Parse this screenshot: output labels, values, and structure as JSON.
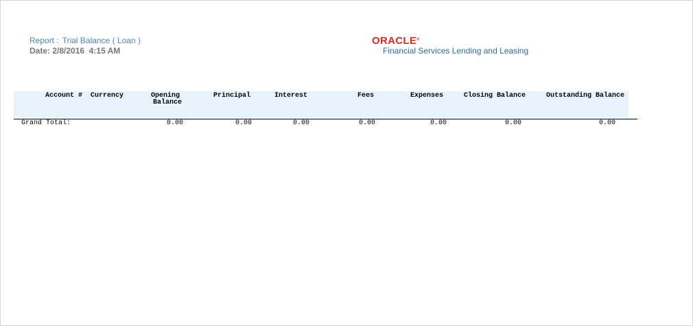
{
  "report": {
    "title_label": "Report :",
    "title_value": "Trial Balance ( Loan )",
    "date_label": "Date:",
    "date_value": "2/8/2016  4:15 AM"
  },
  "logo": {
    "wordmark": "ORACLE",
    "trademark": "®",
    "subtitle": "Financial Services Lending and Leasing",
    "color": "#e2291a"
  },
  "table": {
    "columns": [
      "Account #",
      "Currency",
      "Opening Balance",
      "Principal",
      "Interest",
      "Fees",
      "Expenses",
      "Closing Balance",
      "Outstanding Balance"
    ],
    "opening_line1": "Opening",
    "opening_line2": "Balance",
    "grand_total": {
      "label": "Grand Total:",
      "opening_balance": "0.00",
      "principal": "0.00",
      "interest": "0.00",
      "fees": "0.00",
      "expenses": "0.00",
      "closing_balance": "0.00",
      "outstanding_balance": "0.00"
    }
  },
  "colors": {
    "title": "#4a86c5",
    "date": "#777777",
    "header_bg": "#e8f2fb"
  }
}
